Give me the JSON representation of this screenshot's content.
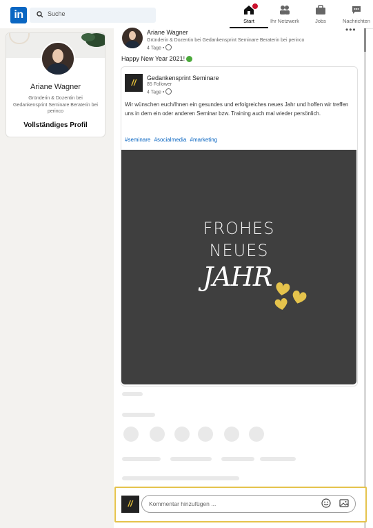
{
  "brand": {
    "logo": "in",
    "accent": "#0a66c2",
    "highlight": "#e5c34c"
  },
  "search": {
    "placeholder": "Suche",
    "icon": "search-icon"
  },
  "nav": [
    {
      "label": "Start",
      "icon": "home-icon",
      "active": true
    },
    {
      "label": "Ihr Netzwerk",
      "icon": "network-icon"
    },
    {
      "label": "Jobs",
      "icon": "briefcase-icon"
    },
    {
      "label": "Nachrichten",
      "icon": "messaging-icon"
    }
  ],
  "profile": {
    "name": "Ariane Wagner",
    "headline": "Gründerin & Dozentin bei Gedankensprint Seminare Beraterin bei perinco",
    "full_profile": "Vollständiges Profil"
  },
  "post": {
    "author": "Ariane Wagner",
    "author_headline": "Gründerin & Dozentin bei Gedankensprint Seminare Beraterin bei perinco",
    "time": "4 Tage •",
    "text": "Happy New Year 2021!",
    "more": "•••",
    "shared": {
      "logo": "//",
      "name": "Gedankensprint Seminare",
      "followers": "85 Follower",
      "time": "4 Tage •",
      "text": "Wir wünschen euch/Ihnen ein gesundes und erfolgreiches neues Jahr und hoffen wir treffen uns in dem ein oder anderen Seminar bzw. Training auch mal wieder persönlich.",
      "hashtags": [
        "#seminare",
        "#socialmedia",
        "#marketing"
      ],
      "image": {
        "line1": "FROHES",
        "line2": "NEUES",
        "line3": "JAHR",
        "bg": "#3f3f3f",
        "heart_color": "#e5c34c"
      }
    }
  },
  "comment": {
    "logo": "//",
    "placeholder": "Kommentar hinzufügen ..."
  }
}
